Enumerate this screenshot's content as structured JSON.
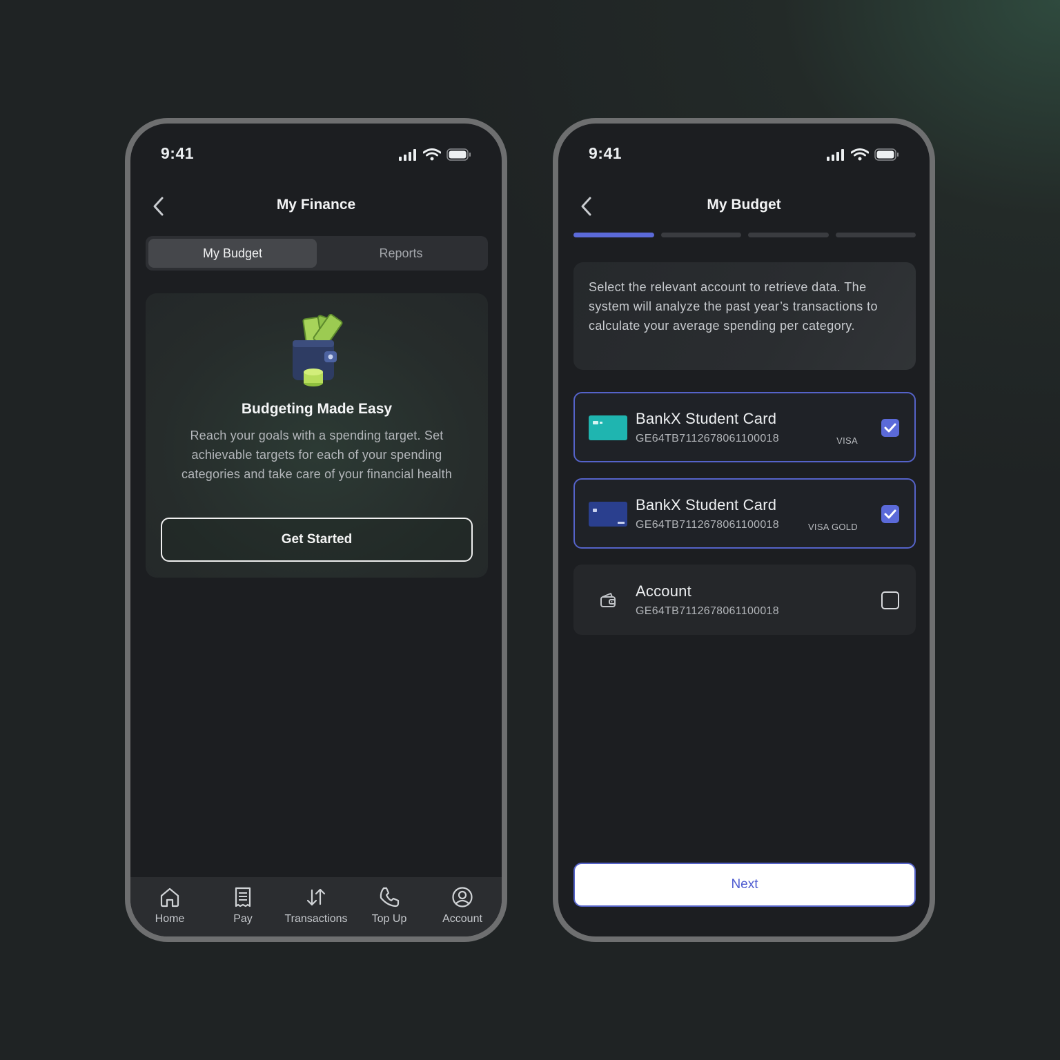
{
  "left": {
    "status": {
      "time": "9:41"
    },
    "header": {
      "title": "My Finance"
    },
    "tabs": [
      {
        "label": "My Budget",
        "active": true
      },
      {
        "label": "Reports",
        "active": false
      }
    ],
    "hero": {
      "title": "Budgeting Made Easy",
      "description": "Reach your goals with a spending target. Set achievable targets for each of your spending categories and take care of your financial health",
      "cta": "Get Started",
      "illustration": "wallet-money-icon"
    },
    "tab_bar": [
      {
        "label": "Home",
        "icon": "home-icon"
      },
      {
        "label": "Pay",
        "icon": "receipt-icon"
      },
      {
        "label": "Transactions",
        "icon": "arrows-up-down-icon"
      },
      {
        "label": "Top Up",
        "icon": "phone-icon"
      },
      {
        "label": "Account",
        "icon": "user-circle-icon"
      }
    ]
  },
  "right": {
    "status": {
      "time": "9:41"
    },
    "header": {
      "title": "My Budget"
    },
    "progress": {
      "current_step": 1,
      "total_steps": 4
    },
    "info": "Select the relevant account to retrieve data. The system will analyze the past year’s transactions to calculate your average spending per category.",
    "accounts": [
      {
        "name": "BankX Student Card",
        "iban": "GE64TB7112678061100018",
        "network": "VISA",
        "checked": true,
        "thumb_color": "#1fb5b0"
      },
      {
        "name": "BankX Student Card",
        "iban": "GE64TB7112678061100018",
        "network": "VISA GOLD",
        "checked": true,
        "thumb_color": "#2a3f8e"
      },
      {
        "name": "Account",
        "iban": "GE64TB7112678061100018",
        "network": "",
        "checked": false,
        "icon": "wallet-icon"
      }
    ],
    "next_label": "Next"
  },
  "colors": {
    "accent": "#5b6ad9",
    "background": "#1c1e21"
  }
}
